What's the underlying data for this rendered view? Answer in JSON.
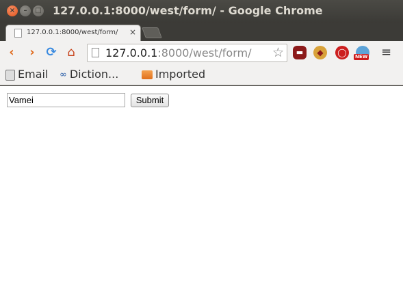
{
  "window": {
    "title": "127.0.0.1:8000/west/form/ - Google Chrome",
    "close_glyph": "×",
    "min_glyph": "–",
    "max_glyph": "□"
  },
  "tabs": [
    {
      "label": "127.0.0.1:8000/west/form/",
      "close_glyph": "×"
    }
  ],
  "toolbar": {
    "back_glyph": "‹",
    "forward_glyph": "›",
    "reload_glyph": "⟳",
    "home_glyph": "⌂",
    "url_host": "127.0.0.1",
    "url_path": ":8000/west/form/",
    "star_glyph": "☆",
    "menu_glyph": "≡",
    "new_badge": "NEW"
  },
  "bookmarks": [
    {
      "label": "Email"
    },
    {
      "label": "Diction..."
    },
    {
      "label": "Imported"
    }
  ],
  "form": {
    "input_value": "Vamei",
    "submit_label": "Submit"
  }
}
